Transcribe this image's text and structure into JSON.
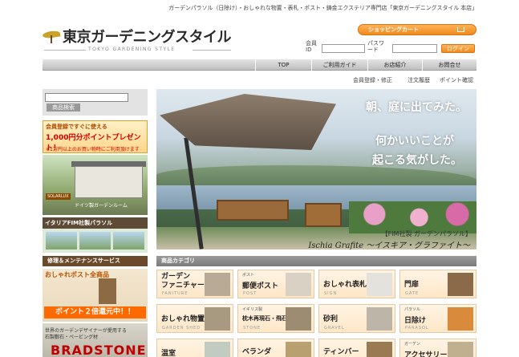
{
  "header": {
    "tagline": "ガーデンパラソル（日除け）・おしゃれな物置・表札・ポスト・鋳金エクステリア専門店「東京ガーデニングスタイル 本店」",
    "logo_text": "東京ガーデニングスタイル",
    "logo_sub": "TOKYO GARDENING STYLE",
    "cart_button": "ショッピングカート",
    "member_label": "会員ID",
    "password_label": "パスワード",
    "login_button": "ログイン"
  },
  "nav": {
    "items": [
      {
        "label": "TOP"
      },
      {
        "label": "ご利用ガイド"
      },
      {
        "label": "お店紹介"
      },
      {
        "label": "お問合せ"
      }
    ]
  },
  "sublinks": {
    "register": "会員登録・修正",
    "orders": "注文履歴",
    "points": "ポイント確認"
  },
  "sidebar": {
    "search_button": "商品検索",
    "banner_register": {
      "line1": "会員登録ですぐに使える",
      "line2": "1,000円分ポイントプレゼント！",
      "line3": "※1万円以上のお買い物時にご利用頂けます"
    },
    "banner_room": {
      "badge": "SOLARLUX",
      "caption": "ドイツ製ガーデンルーム"
    },
    "banner_parasol_title": "イタリアFIM社製パラソル",
    "banner_repair": "修理＆メンテナンスサービス",
    "banner_post": {
      "title": "おしゃれポスト全商品",
      "promo": "ポイント２倍還元中！！"
    },
    "banner_stone": {
      "line1": "世界のガーデンデザイナーが愛用する",
      "line2": "石製敷石・ペービング材",
      "brand": "BRADSTONE"
    }
  },
  "hero": {
    "headline1": "朝、庭に出てみた。",
    "headline2": "何かいいことが",
    "headline3": "起こる気がした。",
    "caption1": "【FIM社製 ガーデンパラソル】",
    "caption2": "Ischia Grafite ～イスキア・グラファイト～"
  },
  "categories": {
    "heading": "商品カテゴリ",
    "tiles": [
      {
        "pre": "",
        "title": "ガーデン\nファニチャー",
        "sub": "FANITURE"
      },
      {
        "pre": "ポスト",
        "title": "郵便ポスト",
        "sub": "POST"
      },
      {
        "pre": "",
        "title": "おしゃれ表札",
        "sub": "SIGN"
      },
      {
        "pre": "",
        "title": "門扉",
        "sub": "GATE"
      },
      {
        "pre": "",
        "title": "おしゃれ物置",
        "sub": "GARDEN SHED"
      },
      {
        "pre": "イギリス製",
        "title": "枕木再現石・飛石",
        "sub": "STONE"
      },
      {
        "pre": "",
        "title": "砂利",
        "sub": "GRAVEL"
      },
      {
        "pre": "パラソル",
        "title": "日除け",
        "sub": "PARASOL"
      },
      {
        "pre": "",
        "title": "温室",
        "sub": ""
      },
      {
        "pre": "",
        "title": "ベランダ",
        "sub": ""
      },
      {
        "pre": "",
        "title": "ティンバー",
        "sub": ""
      },
      {
        "pre": "ガーデン",
        "title": "アクセサリー",
        "sub": ""
      }
    ]
  }
}
